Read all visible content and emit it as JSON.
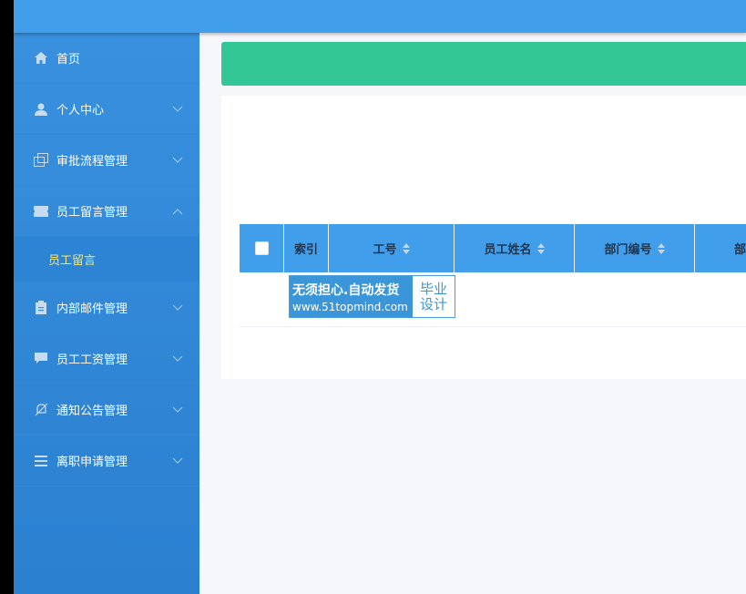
{
  "sidebar": {
    "items": [
      {
        "label": "首页",
        "icon": "home-icon"
      },
      {
        "label": "个人中心",
        "icon": "user-icon"
      },
      {
        "label": "审批流程管理",
        "icon": "copy-icon"
      },
      {
        "label": "员工留言管理",
        "icon": "ticket-icon",
        "expanded": true
      },
      {
        "label": "内部邮件管理",
        "icon": "clipboard-icon"
      },
      {
        "label": "员工工资管理",
        "icon": "chat-icon"
      },
      {
        "label": "通知公告管理",
        "icon": "bell-off-icon"
      },
      {
        "label": "离职申请管理",
        "icon": "list-icon"
      }
    ],
    "sub_items": [
      {
        "label": "员工留言",
        "active": true
      }
    ]
  },
  "table": {
    "columns": [
      "索引",
      "工号",
      "员工姓名",
      "部门编号",
      "部"
    ]
  },
  "watermark": {
    "line1": "无须担心.自动发货",
    "line2": "www.51topmind.com",
    "right1": "毕业",
    "right2": "设计"
  },
  "colors": {
    "topbar": "#409eea",
    "sidebar": "#3890de",
    "banner": "#33c796",
    "active_sub": "#f7e76b",
    "divider": "#2a9d8f"
  }
}
